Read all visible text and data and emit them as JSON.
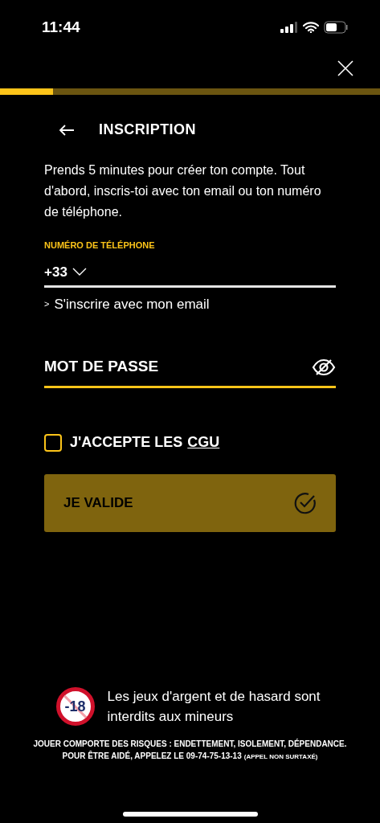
{
  "status_bar": {
    "time": "11:44"
  },
  "progress": {
    "level": 0.14
  },
  "header": {
    "title": "INSCRIPTION"
  },
  "intro": "Prends 5 minutes pour créer ton compte. Tout d'abord, inscris-toi avec ton email ou ton numéro de téléphone.",
  "phone_field": {
    "label": "NUMÉRO DE TÉLÉPHONE",
    "country_code": "+33"
  },
  "email_link": {
    "arrow": ">",
    "label": "S'inscrire avec mon email"
  },
  "password_field": {
    "placeholder": "MOT DE PASSE"
  },
  "terms": {
    "checked": false,
    "label": "J'ACCEPTE LES",
    "link": "CGU"
  },
  "submit": {
    "label": "JE VALIDE",
    "disabled": true
  },
  "footer": {
    "age_badge": "-18",
    "notice": "Les jeux d'argent et de hasard sont interdits aux mineurs",
    "risk_line": "JOUER COMPORTE DES RISQUES : ENDETTEMENT, ISOLEMENT, DÉPENDANCE.",
    "help_line": "POUR ÊTRE AIDÉ, APPELEZ LE 09-74-75-13-13",
    "help_note": "(APPEL NON SURTAXÉ)"
  }
}
